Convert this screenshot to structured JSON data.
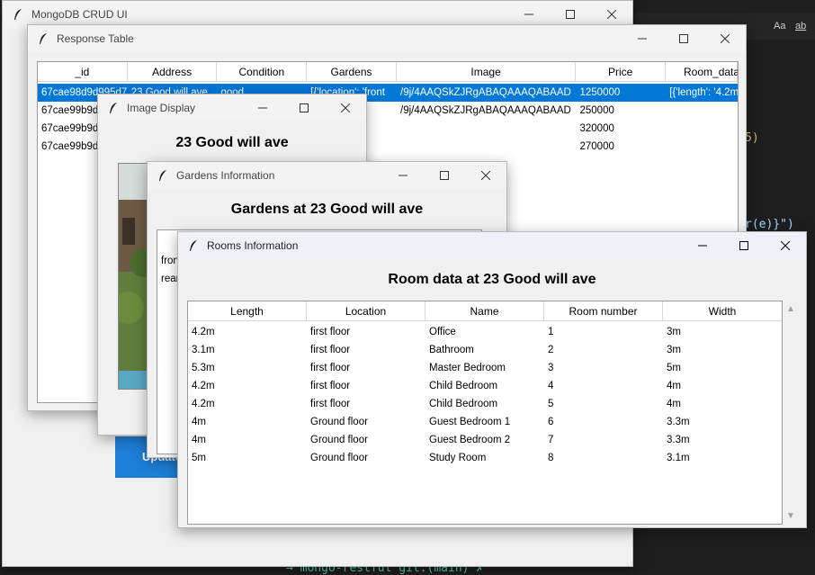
{
  "editor": {
    "find_case_label": "Aa",
    "find_word_label": "ab",
    "code_fragment_1": "5)",
    "code_fragment_2": "r(e)}\")",
    "terminal_line": "→ mongo-restful git:(main) ✗"
  },
  "main_window": {
    "title": "MongoDB CRUD UI",
    "update_button": "Update"
  },
  "response_window": {
    "title": "Response Table",
    "columns": [
      "_id",
      "Address",
      "Condition",
      "Gardens",
      "Image",
      "Price",
      "Room_data"
    ],
    "rows": [
      [
        "67cae98d9d995d7",
        "23 Good will ave",
        "good",
        "[{'location': 'front",
        "/9j/4AAQSkZJRgABAQAAAQABAAD",
        "1250000",
        "[{'length': '4.2m"
      ],
      [
        "67cae99b9d",
        "",
        "",
        "",
        "/9j/4AAQSkZJRgABAQAAAQABAAD",
        "250000",
        ""
      ],
      [
        "67cae99b9d",
        "",
        "",
        "",
        "",
        "320000",
        ""
      ],
      [
        "67cae99b9d",
        "",
        "",
        "",
        "",
        "270000",
        ""
      ]
    ]
  },
  "image_window": {
    "title": "Image Display",
    "heading": "23 Good will ave"
  },
  "gardens_window": {
    "title": "Gardens Information",
    "heading": "Gardens at 23 Good will ave",
    "items": [
      "fron",
      "rear"
    ]
  },
  "rooms_window": {
    "title": "Rooms Information",
    "heading": "Room data at 23 Good will ave",
    "columns": [
      "Length",
      "Location",
      "Name",
      "Room number",
      "Width"
    ],
    "rows": [
      [
        "4.2m",
        "first floor",
        "Office",
        "1",
        "3m"
      ],
      [
        "3.1m",
        "first floor",
        "Bathroom",
        "2",
        "3m"
      ],
      [
        "5.3m",
        "first floor",
        "Master Bedroom",
        "3",
        "5m"
      ],
      [
        "4.2m",
        "first floor",
        "Child Bedroom",
        "4",
        "4m"
      ],
      [
        "4.2m",
        "first floor",
        "Child Bedroom",
        "5",
        "4m"
      ],
      [
        "4m",
        "Ground floor",
        "Guest Bedroom 1",
        "6",
        "3.3m"
      ],
      [
        "4m",
        "Ground floor",
        "Guest Bedroom 2",
        "7",
        "3.3m"
      ],
      [
        "5m",
        "Ground floor",
        "Study Room",
        "8",
        "3.1m"
      ]
    ]
  },
  "colors": {
    "selection": "#0078d7",
    "update_button": "#1e7fd8"
  },
  "icons": [
    "feather-icon",
    "minimize-icon",
    "maximize-icon",
    "close-icon",
    "scroll-up-icon",
    "scroll-down-icon"
  ]
}
